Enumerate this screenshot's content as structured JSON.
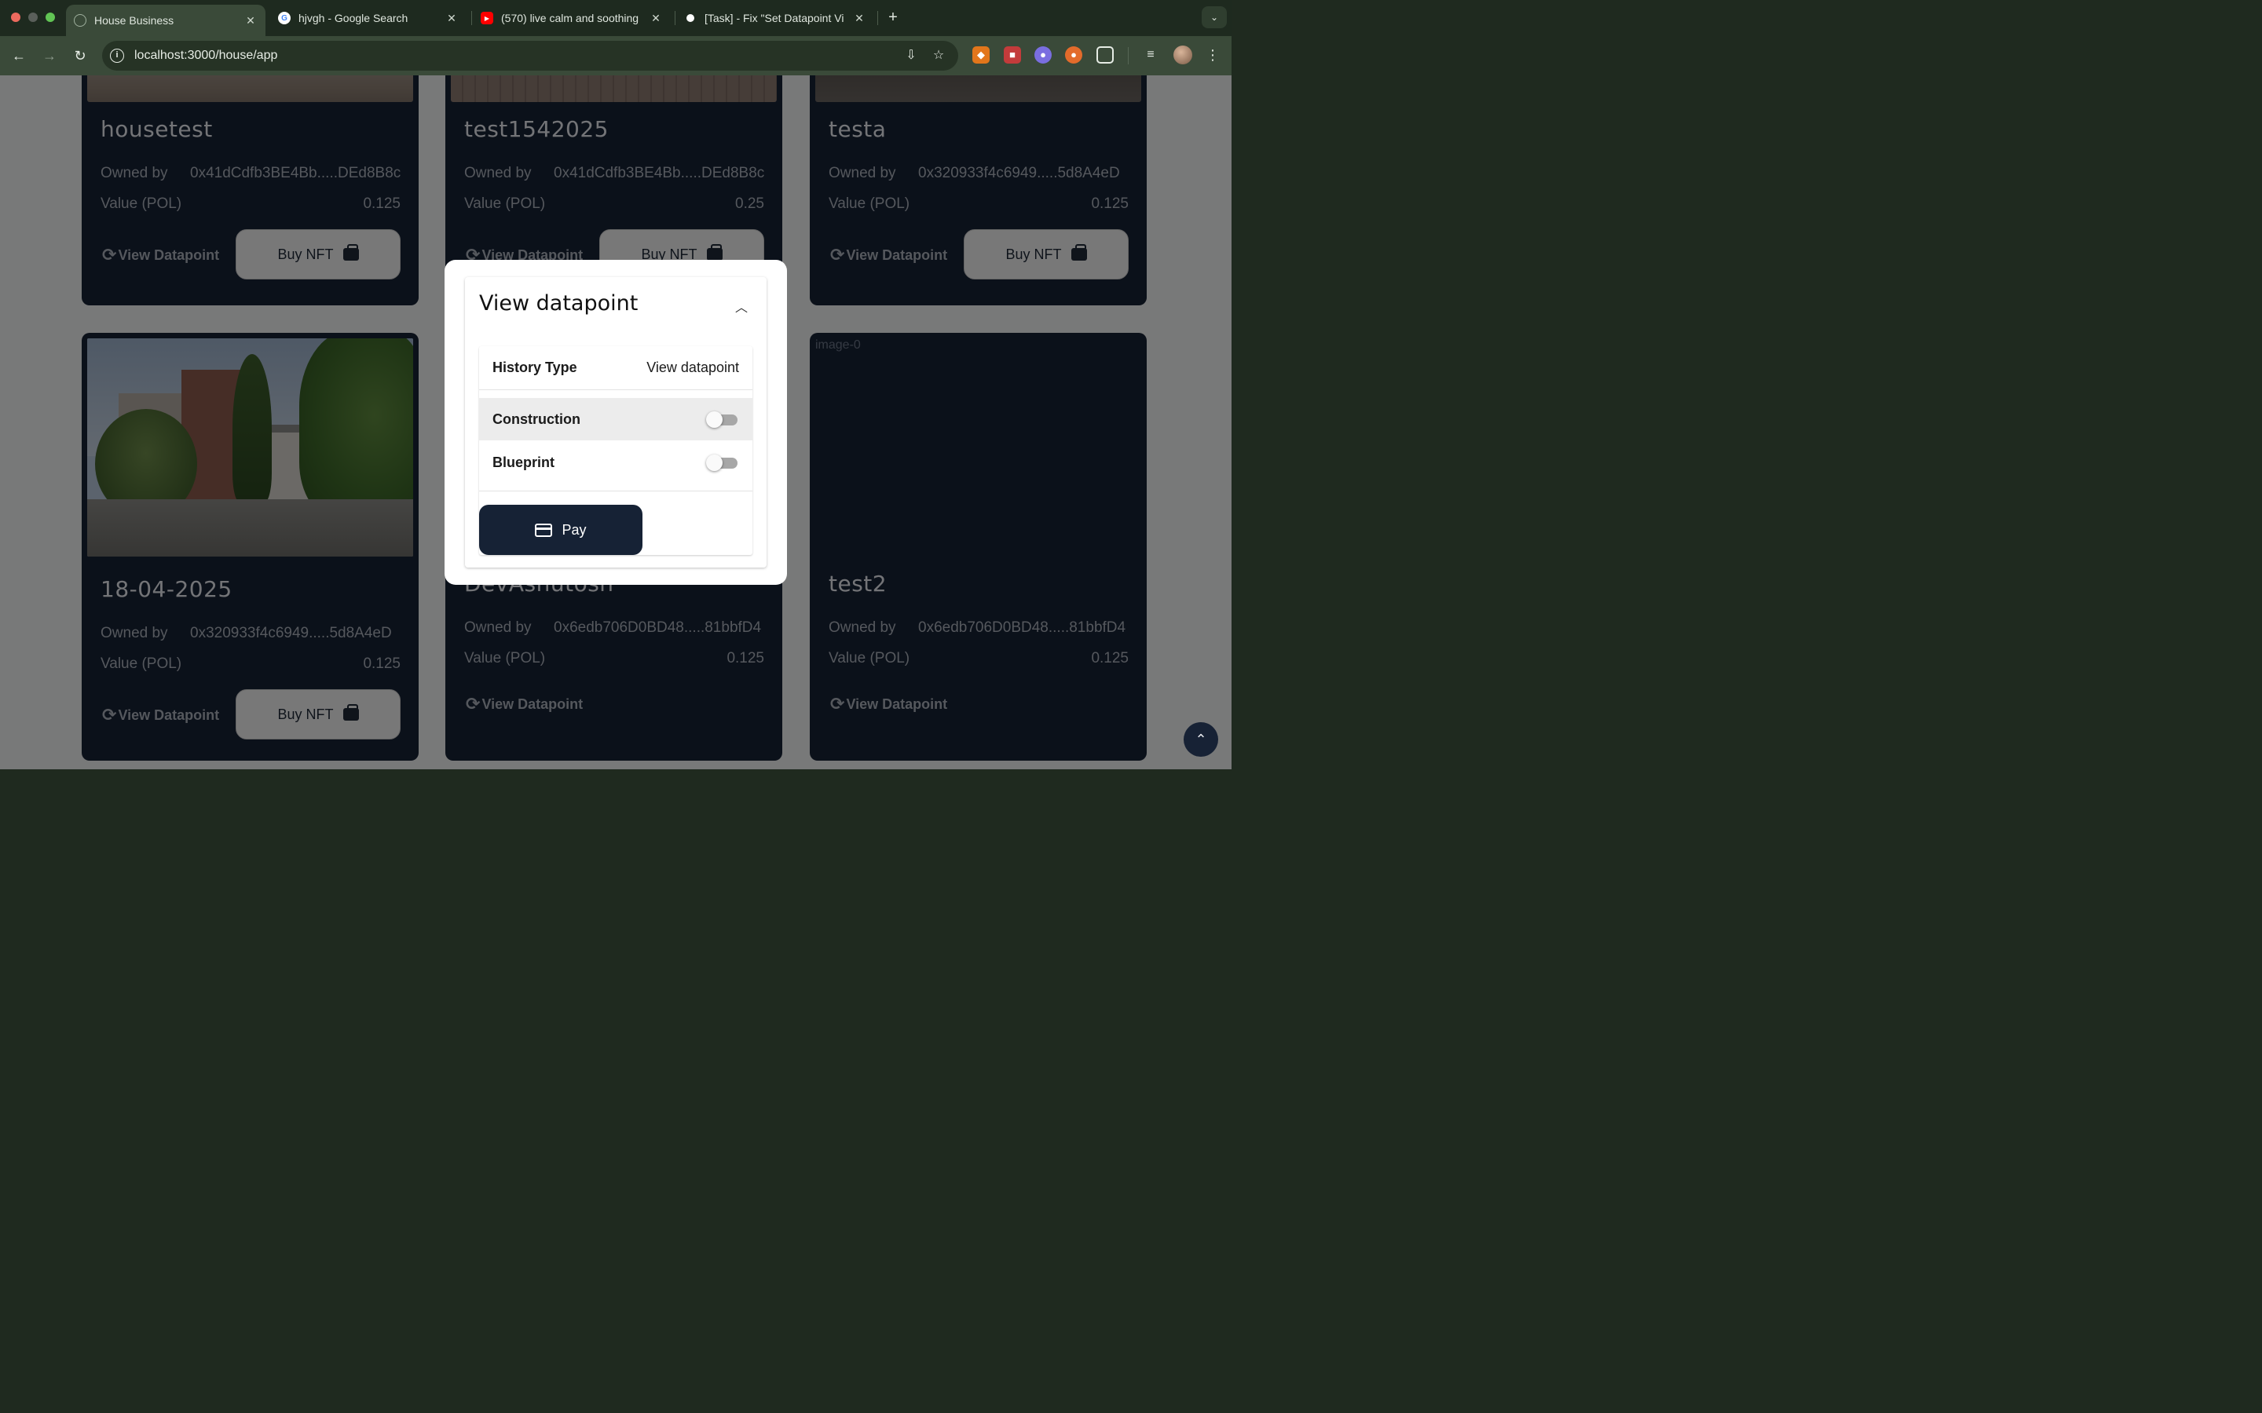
{
  "browser": {
    "tabs": [
      {
        "title": "House Business",
        "icon": "house-icon"
      },
      {
        "title": "hjvgh - Google Search",
        "icon": "google-icon"
      },
      {
        "title": "(570) live calm and soothing",
        "icon": "youtube-icon"
      },
      {
        "title": "[Task] - Fix \"Set Datapoint Vi",
        "icon": "github-icon"
      }
    ],
    "url": "localhost:3000/house/app"
  },
  "cards": [
    {
      "title": "housetest",
      "owned_label": "Owned by",
      "owner": "0x41dCdfb3BE4Bb.....DEd8B8c",
      "value_label": "Value (POL)",
      "value": "0.125",
      "view_label": "View Datapoint",
      "buy_label": "Buy NFT"
    },
    {
      "title": "test1542025",
      "owned_label": "Owned by",
      "owner": "0x41dCdfb3BE4Bb.....DEd8B8c",
      "value_label": "Value (POL)",
      "value": "0.25",
      "view_label": "View Datapoint",
      "buy_label": "Buy NFT"
    },
    {
      "title": "testa",
      "owned_label": "Owned by",
      "owner": "0x320933f4c6949.....5d8A4eD",
      "value_label": "Value (POL)",
      "value": "0.125",
      "view_label": "View Datapoint",
      "buy_label": "Buy NFT"
    },
    {
      "title": "18-04-2025",
      "owned_label": "Owned by",
      "owner": "0x320933f4c6949.....5d8A4eD",
      "value_label": "Value (POL)",
      "value": "0.125",
      "view_label": "View Datapoint",
      "buy_label": "Buy NFT"
    },
    {
      "title": "DevAshutosh",
      "owned_label": "Owned by",
      "owner": "0x6edb706D0BD48.....81bbfD4",
      "value_label": "Value (POL)",
      "value": "0.125",
      "view_label": "View Datapoint"
    },
    {
      "title": "test2",
      "owned_label": "Owned by",
      "owner": "0x6edb706D0BD48.....81bbfD4",
      "value_label": "Value (POL)",
      "value": "0.125",
      "view_label": "View Datapoint",
      "image_alt": "image-0"
    }
  ],
  "modal": {
    "title": "View datapoint",
    "history_type_label": "History Type",
    "history_type_value": "View datapoint",
    "options": [
      {
        "label": "Construction",
        "checked": false
      },
      {
        "label": "Blueprint",
        "checked": false
      }
    ],
    "pay_label": "Pay"
  },
  "colors": {
    "card_bg": "#172235",
    "page_bg": "#f1f2f2",
    "pay_button": "#162235",
    "chrome_bg": "#1e2a1f"
  }
}
